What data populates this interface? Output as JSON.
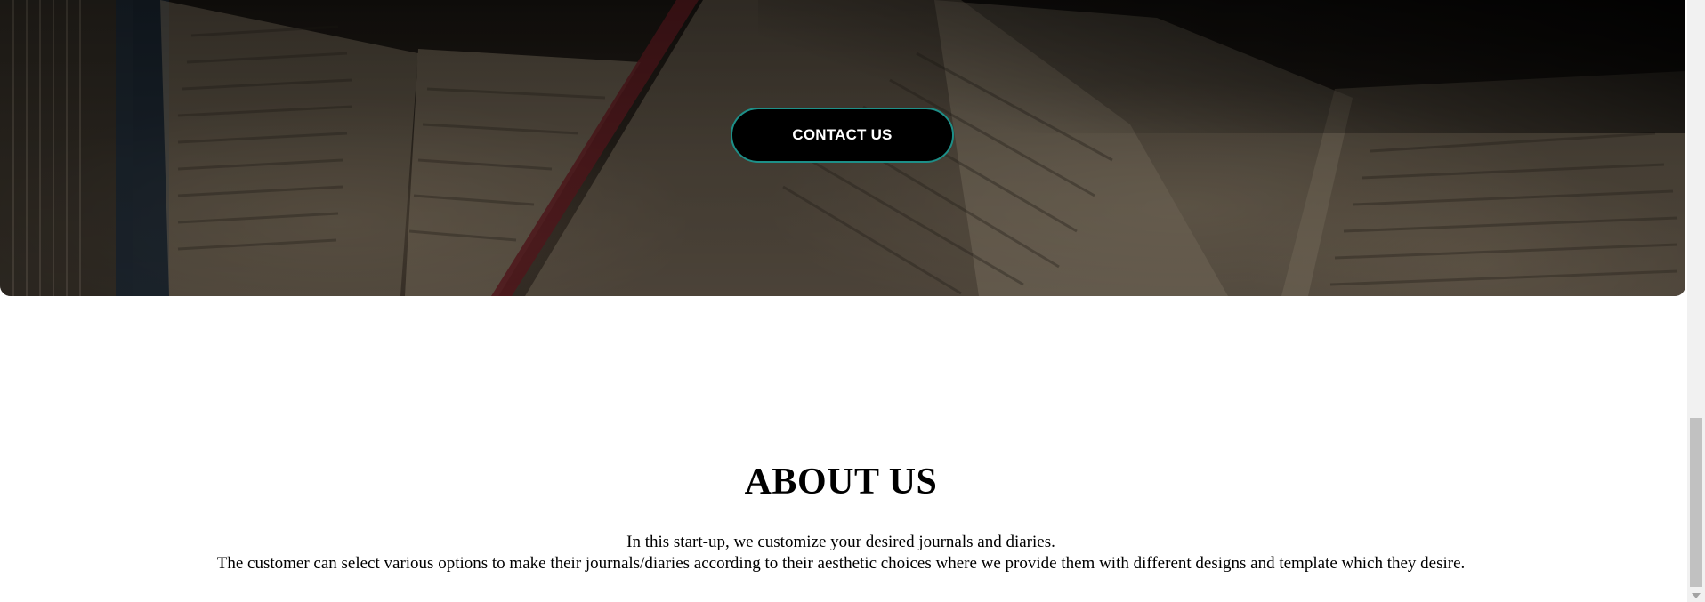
{
  "hero": {
    "contact_button_label": "CONTACT US",
    "background_image": "open-books-photo",
    "button_border_color": "#1d8f88",
    "button_background_color": "#000000"
  },
  "about": {
    "title": "ABOUT US",
    "lines": [
      "In this start-up, we customize your desired journals and diaries.",
      "The customer can select various options to make their journals/diaries according to their aesthetic choices where we provide them with different designs and template which they desire."
    ]
  },
  "scrollbar": {
    "arrow_icon": "chevron-down-icon"
  }
}
